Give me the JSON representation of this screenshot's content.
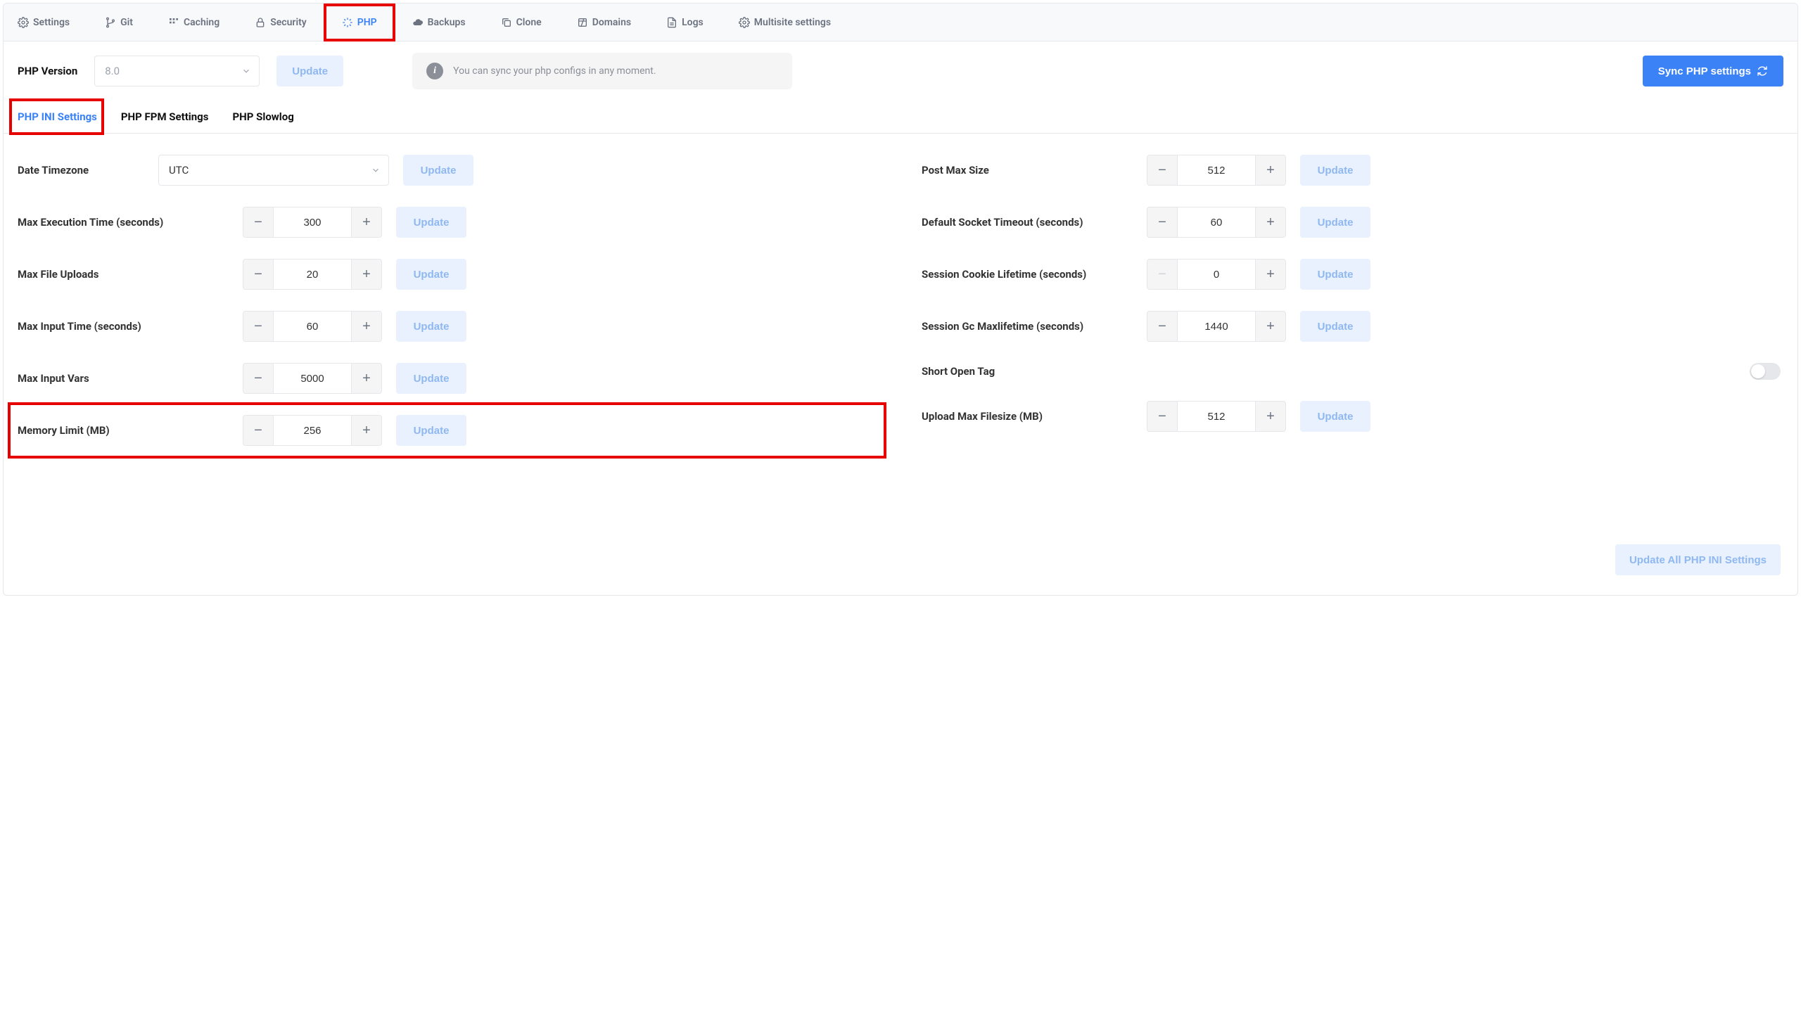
{
  "topTabs": {
    "settings": "Settings",
    "git": "Git",
    "caching": "Caching",
    "security": "Security",
    "php": "PHP",
    "backups": "Backups",
    "clone": "Clone",
    "domains": "Domains",
    "logs": "Logs",
    "multisite": "Multisite settings"
  },
  "version": {
    "label": "PHP Version",
    "value": "8.0",
    "update": "Update"
  },
  "info": {
    "text": "You can sync your php configs in any moment."
  },
  "syncBtn": "Sync PHP settings",
  "subTabs": {
    "ini": "PHP INI Settings",
    "fpm": "PHP FPM Settings",
    "slowlog": "PHP Slowlog"
  },
  "labels": {
    "dateTimezone": "Date Timezone",
    "maxExec": "Max Execution Time (seconds)",
    "maxFileUploads": "Max File Uploads",
    "maxInputTime": "Max Input Time (seconds)",
    "maxInputVars": "Max Input Vars",
    "memoryLimit": "Memory Limit (MB)",
    "postMaxSize": "Post Max Size",
    "defSocketTimeout": "Default Socket Timeout (seconds)",
    "sessCookieLifetime": "Session Cookie Lifetime (seconds)",
    "sessGcMaxlifetime": "Session Gc Maxlifetime (seconds)",
    "shortOpenTag": "Short Open Tag",
    "uploadMaxFilesize": "Upload Max Filesize (MB)"
  },
  "values": {
    "dateTimezone": "UTC",
    "maxExec": "300",
    "maxFileUploads": "20",
    "maxInputTime": "60",
    "maxInputVars": "5000",
    "memoryLimit": "256",
    "postMaxSize": "512",
    "defSocketTimeout": "60",
    "sessCookieLifetime": "0",
    "sessGcMaxlifetime": "1440",
    "uploadMaxFilesize": "512"
  },
  "updateLabel": "Update",
  "updateAll": "Update All PHP INI Settings"
}
